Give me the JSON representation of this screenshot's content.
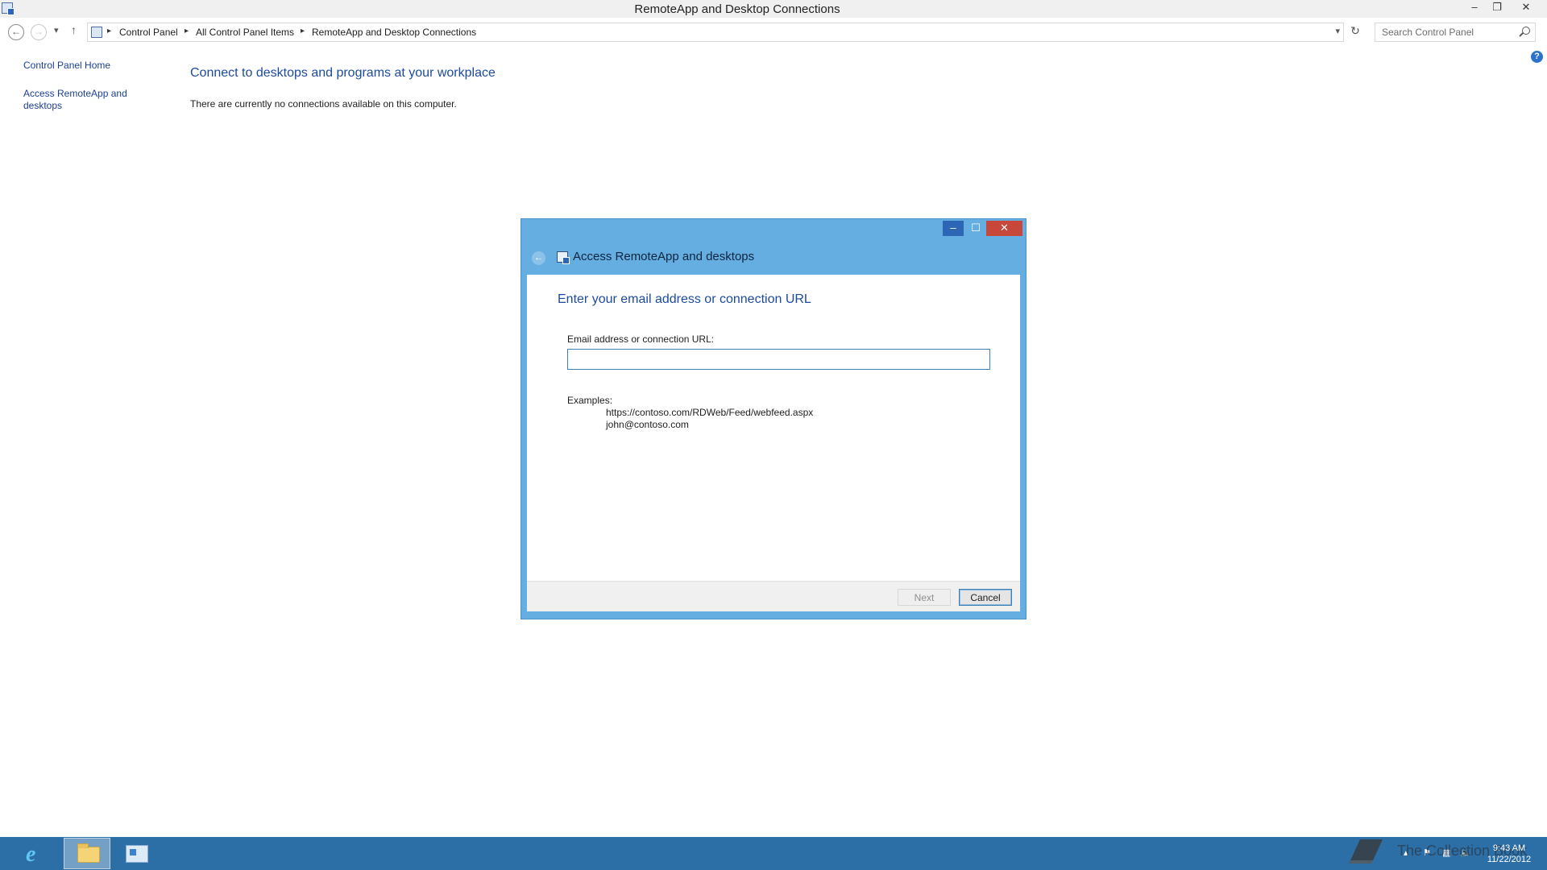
{
  "window": {
    "title": "RemoteApp and Desktop Connections",
    "controls": {
      "minimize": "–",
      "restore": "❐",
      "close": "✕"
    }
  },
  "address_bar": {
    "breadcrumbs": [
      "Control Panel",
      "All Control Panel Items",
      "RemoteApp and Desktop Connections"
    ],
    "search_placeholder": "Search Control Panel"
  },
  "left_pane": {
    "links": [
      "Control Panel Home",
      "Access RemoteApp and desktops"
    ]
  },
  "main": {
    "heading": "Connect to desktops and programs at your workplace",
    "status_text": "There are currently no connections available on this computer."
  },
  "dialog": {
    "title": "Access RemoteApp and desktops",
    "heading": "Enter your email address or connection URL",
    "field_label": "Email address or connection URL:",
    "field_value": "",
    "examples_label": "Examples:",
    "examples": [
      "https://contoso.com/RDWeb/Feed/webfeed.aspx",
      "john@contoso.com"
    ],
    "buttons": {
      "next": "Next",
      "cancel": "Cancel"
    },
    "colors": {
      "frame": "#64aee1",
      "close": "#c7473a",
      "heading": "#1c4a9e"
    }
  },
  "taskbar": {
    "apps": [
      "internet-explorer",
      "file-explorer",
      "control-panel"
    ],
    "watermark": "The Collection Book",
    "clock": {
      "time": "9:43 AM",
      "date": "11/22/2012"
    },
    "color": "#2c6ea6"
  }
}
